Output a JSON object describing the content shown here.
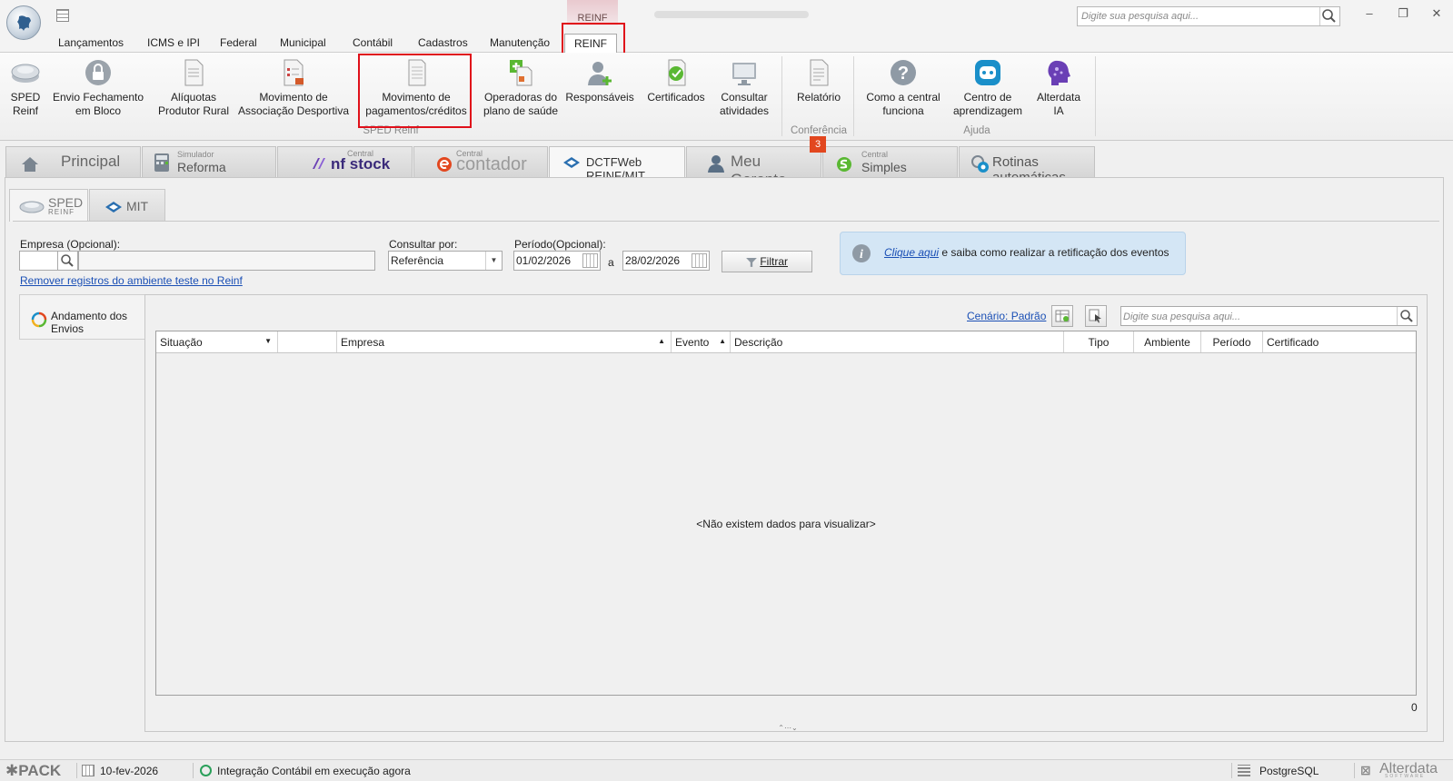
{
  "titlebar": {
    "context_tab": "REINF",
    "search_placeholder": "Digite sua pesquisa aqui..."
  },
  "menu": {
    "items": [
      "Lançamentos",
      "ICMS e IPI",
      "Federal",
      "Municipal",
      "Contábil",
      "Cadastros",
      "Manutenção",
      "REINF"
    ]
  },
  "ribbon": {
    "buttons": [
      {
        "line1": "SPED",
        "line2": "Reinf"
      },
      {
        "line1": "Envio Fechamento",
        "line2": "em Bloco"
      },
      {
        "line1": "Alíquotas",
        "line2": "Produtor Rural"
      },
      {
        "line1": "Movimento de",
        "line2": "Associação Desportiva"
      },
      {
        "line1": "Movimento de",
        "line2": "pagamentos/créditos"
      },
      {
        "line1": "Operadoras do",
        "line2": "plano de saúde"
      },
      {
        "line1": "Responsáveis",
        "line2": ""
      },
      {
        "line1": "Certificados",
        "line2": ""
      },
      {
        "line1": "Consultar",
        "line2": "atividades"
      },
      {
        "line1": "Relatório",
        "line2": ""
      },
      {
        "line1": "Como a central",
        "line2": "funciona"
      },
      {
        "line1": "Centro de",
        "line2": "aprendizagem"
      },
      {
        "line1": "Alterdata",
        "line2": "IA"
      }
    ],
    "groups": [
      "SPED Reinf",
      "Conferência",
      "Ajuda"
    ],
    "badge": "3"
  },
  "main_tabs": {
    "principal": "Principal",
    "simulador_small": "Simulador",
    "simulador": "Reforma Tributária",
    "central_small": "Central",
    "nfstock": "nf stock",
    "contador": "contador",
    "dctfweb": "DCTFWeb REINF/MIT",
    "meu_gerente": "Meu Gerente",
    "simples": "Simples Nacional",
    "rotinas": "Rotinas automáticas"
  },
  "sub_tabs": {
    "sped": "SPED",
    "reinf": "REINF",
    "mit": "MIT"
  },
  "form": {
    "empresa_label": "Empresa (Opcional):",
    "consultar_label": "Consultar por:",
    "consultar_value": "Referência",
    "periodo_label": "Período(Opcional):",
    "date_from": "01/02/2026",
    "date_sep": "a",
    "date_to": "28/02/2026",
    "filtrar": "Filtrar",
    "remove_link": "Remover registros do ambiente teste no Reinf",
    "info_link": "Clique aqui",
    "info_text": " e saiba como realizar a retificação dos eventos"
  },
  "andamento": {
    "title": "Andamento dos Envios",
    "cenario": "Cenário: Padrão",
    "search_placeholder": "Digite sua pesquisa aqui...",
    "columns": [
      "Situação",
      "",
      "Empresa",
      "Evento",
      "Descrição",
      "Tipo",
      "Ambiente",
      "Período",
      "Certificado"
    ],
    "empty": "<Não existem dados para visualizar>",
    "count": "0"
  },
  "statusbar": {
    "pack": "PACK",
    "date": "10-fev-2026",
    "integracao": "Integração Contábil em execução agora",
    "db": "PostgreSQL",
    "brand": "Alterdata",
    "brand_sub": "SOFTWARE"
  },
  "colors": {
    "highlight": "#e0101a",
    "link": "#1a4fb5",
    "info_bg": "#d4e6f5",
    "badge": "#e2471f"
  }
}
